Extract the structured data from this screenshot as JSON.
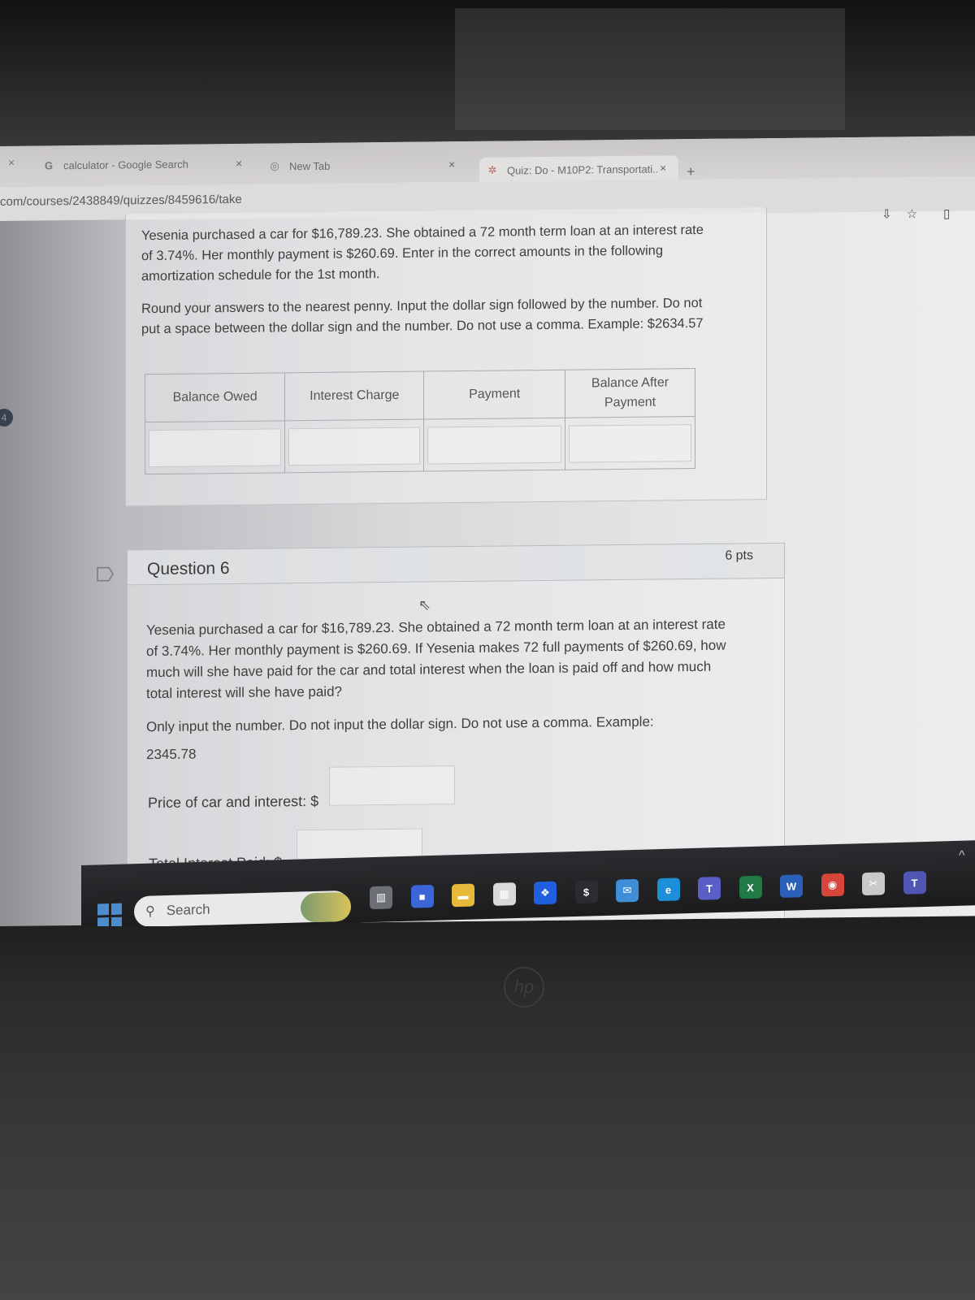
{
  "browser": {
    "tabs": [
      {
        "label": "calculator - Google Search",
        "icon": "google-g-icon",
        "active": false
      },
      {
        "label": "New Tab",
        "icon": "chrome-icon",
        "active": false
      },
      {
        "label": "Quiz: Do - M10P2: Transportati...",
        "icon": "canvas-icon",
        "active": true
      }
    ],
    "close_glyph": "×",
    "new_tab_glyph": "+",
    "url": "com/courses/2438849/quizzes/8459616/take",
    "toolbar_icons": [
      "install-app-icon",
      "bookmark-star-icon",
      "side-panel-icon"
    ]
  },
  "sidebar": {
    "badge_count": "4"
  },
  "question5": {
    "paragraph1": "Yesenia purchased a car for $16,789.23. She obtained a 72 month term loan at an interest rate of 3.74%. Her monthly payment is $260.69. Enter in the correct amounts in the following amortization schedule for the 1st month.",
    "paragraph2": "Round your answers to the nearest penny. Input the dollar sign followed by the number. Do not put a space between the dollar sign and the number. Do not use a comma. Example: $2634.57",
    "table": {
      "headers": [
        "Balance Owed",
        "Interest Charge",
        "Payment",
        "Balance After Payment"
      ],
      "row_values": [
        "",
        "",
        "",
        ""
      ]
    }
  },
  "question6": {
    "title": "Question 6",
    "points": "6 pts",
    "paragraph1": "Yesenia purchased a car for $16,789.23. She obtained a 72 month term loan at an interest rate of 3.74%. Her monthly payment is $260.69. If Yesenia makes 72 full payments of $260.69, how much will she have paid for the car and total interest when the loan is paid off and how much total interest will she have paid?",
    "paragraph2": "Only input the number. Do not input the dollar sign. Do not use a comma. Example: 2345.78",
    "fields": [
      {
        "label": "Price of car and interest: $",
        "value": ""
      },
      {
        "label": "Total Interest Paid: $",
        "value": ""
      }
    ]
  },
  "taskbar": {
    "search_placeholder": "Search",
    "apps": [
      {
        "name": "task-view",
        "glyph": "▥",
        "color": "#6c6f75"
      },
      {
        "name": "zoom-meet",
        "glyph": "■",
        "color": "#3c66d8"
      },
      {
        "name": "file-explorer",
        "glyph": "▬",
        "color": "#e7b93a"
      },
      {
        "name": "microsoft-store",
        "glyph": "▦",
        "color": "#d9d9d9"
      },
      {
        "name": "dropbox",
        "glyph": "❖",
        "color": "#1f5fe0"
      },
      {
        "name": "cash-app",
        "glyph": "$",
        "color": "#2b2c2f"
      },
      {
        "name": "mail",
        "glyph": "✉",
        "color": "#3f8fd8"
      },
      {
        "name": "edge",
        "glyph": "e",
        "color": "#1d8fd6"
      },
      {
        "name": "teams-new",
        "glyph": "T",
        "color": "#5a5fc7"
      },
      {
        "name": "excel",
        "glyph": "X",
        "color": "#1f7a45"
      },
      {
        "name": "word",
        "glyph": "W",
        "color": "#2b5fb8"
      },
      {
        "name": "chrome",
        "glyph": "◉",
        "color": "#d8453b"
      },
      {
        "name": "snipping-tool",
        "glyph": "✂",
        "color": "#c9c9c9"
      },
      {
        "name": "teams",
        "glyph": "T",
        "color": "#4f56b3"
      }
    ],
    "overflow_glyph": "^"
  },
  "device": {
    "logo": "hp"
  }
}
